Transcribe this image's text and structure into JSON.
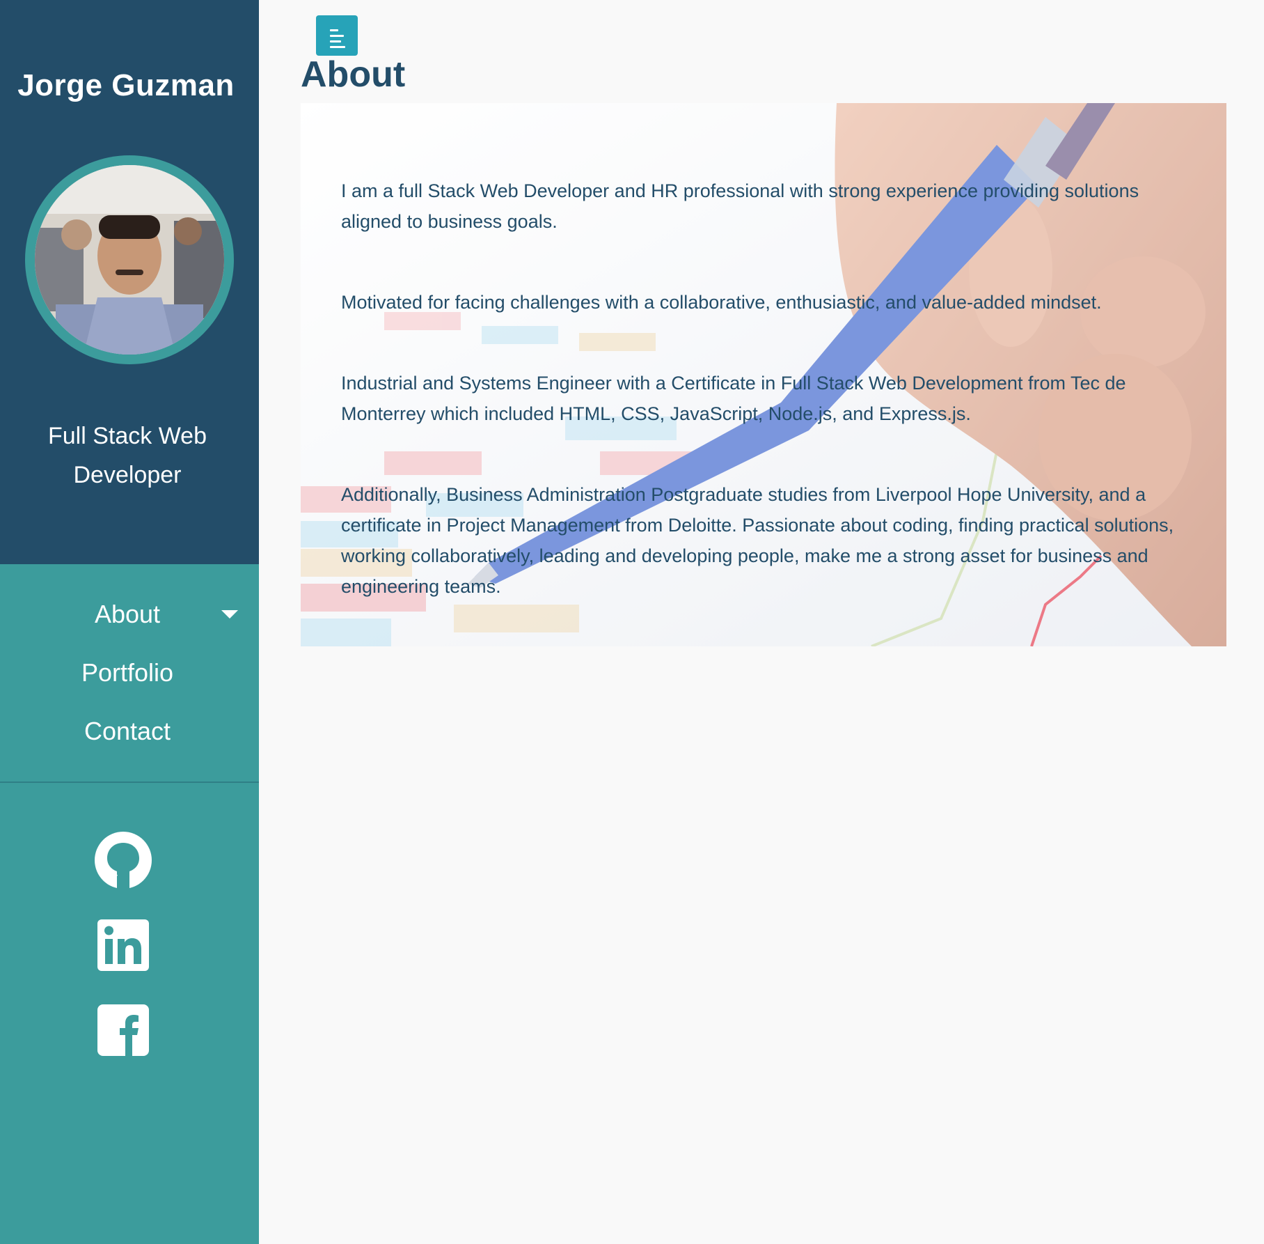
{
  "sidebar": {
    "name": "Jorge Guzman",
    "role": "Full Stack Web Developer",
    "nav": [
      {
        "label": "About"
      },
      {
        "label": "Portfolio"
      },
      {
        "label": "Contact"
      }
    ],
    "social_icons": [
      "github-icon",
      "linkedin-icon",
      "facebook-icon"
    ]
  },
  "main": {
    "toggle_icon": "menu-toggle-icon",
    "title": "About",
    "paragraphs": [
      "I am a full Stack Web Developer and HR professional with strong experience providing solutions aligned to business goals.",
      "Motivated for facing challenges with a collaborative, enthusiastic, and value-added mindset.",
      "Industrial and Systems Engineer with a Certificate in Full Stack Web Development from Tec de Monterrey which included HTML, CSS, JavaScript, Node.js, and Express.js.",
      "Additionally, Business Administration Postgraduate studies from Liverpool Hope University, and a certificate in Project Management from Deloitte. Passionate about coding, finding practical solutions, working collaboratively, leading and developing people, make me a strong asset for business and engineering teams."
    ]
  },
  "colors": {
    "sidebar_dark": "#234d69",
    "sidebar_teal": "#3c9c9c",
    "toggle": "#27a3b8",
    "background": "#f9f9f9",
    "text": "#234d69"
  }
}
